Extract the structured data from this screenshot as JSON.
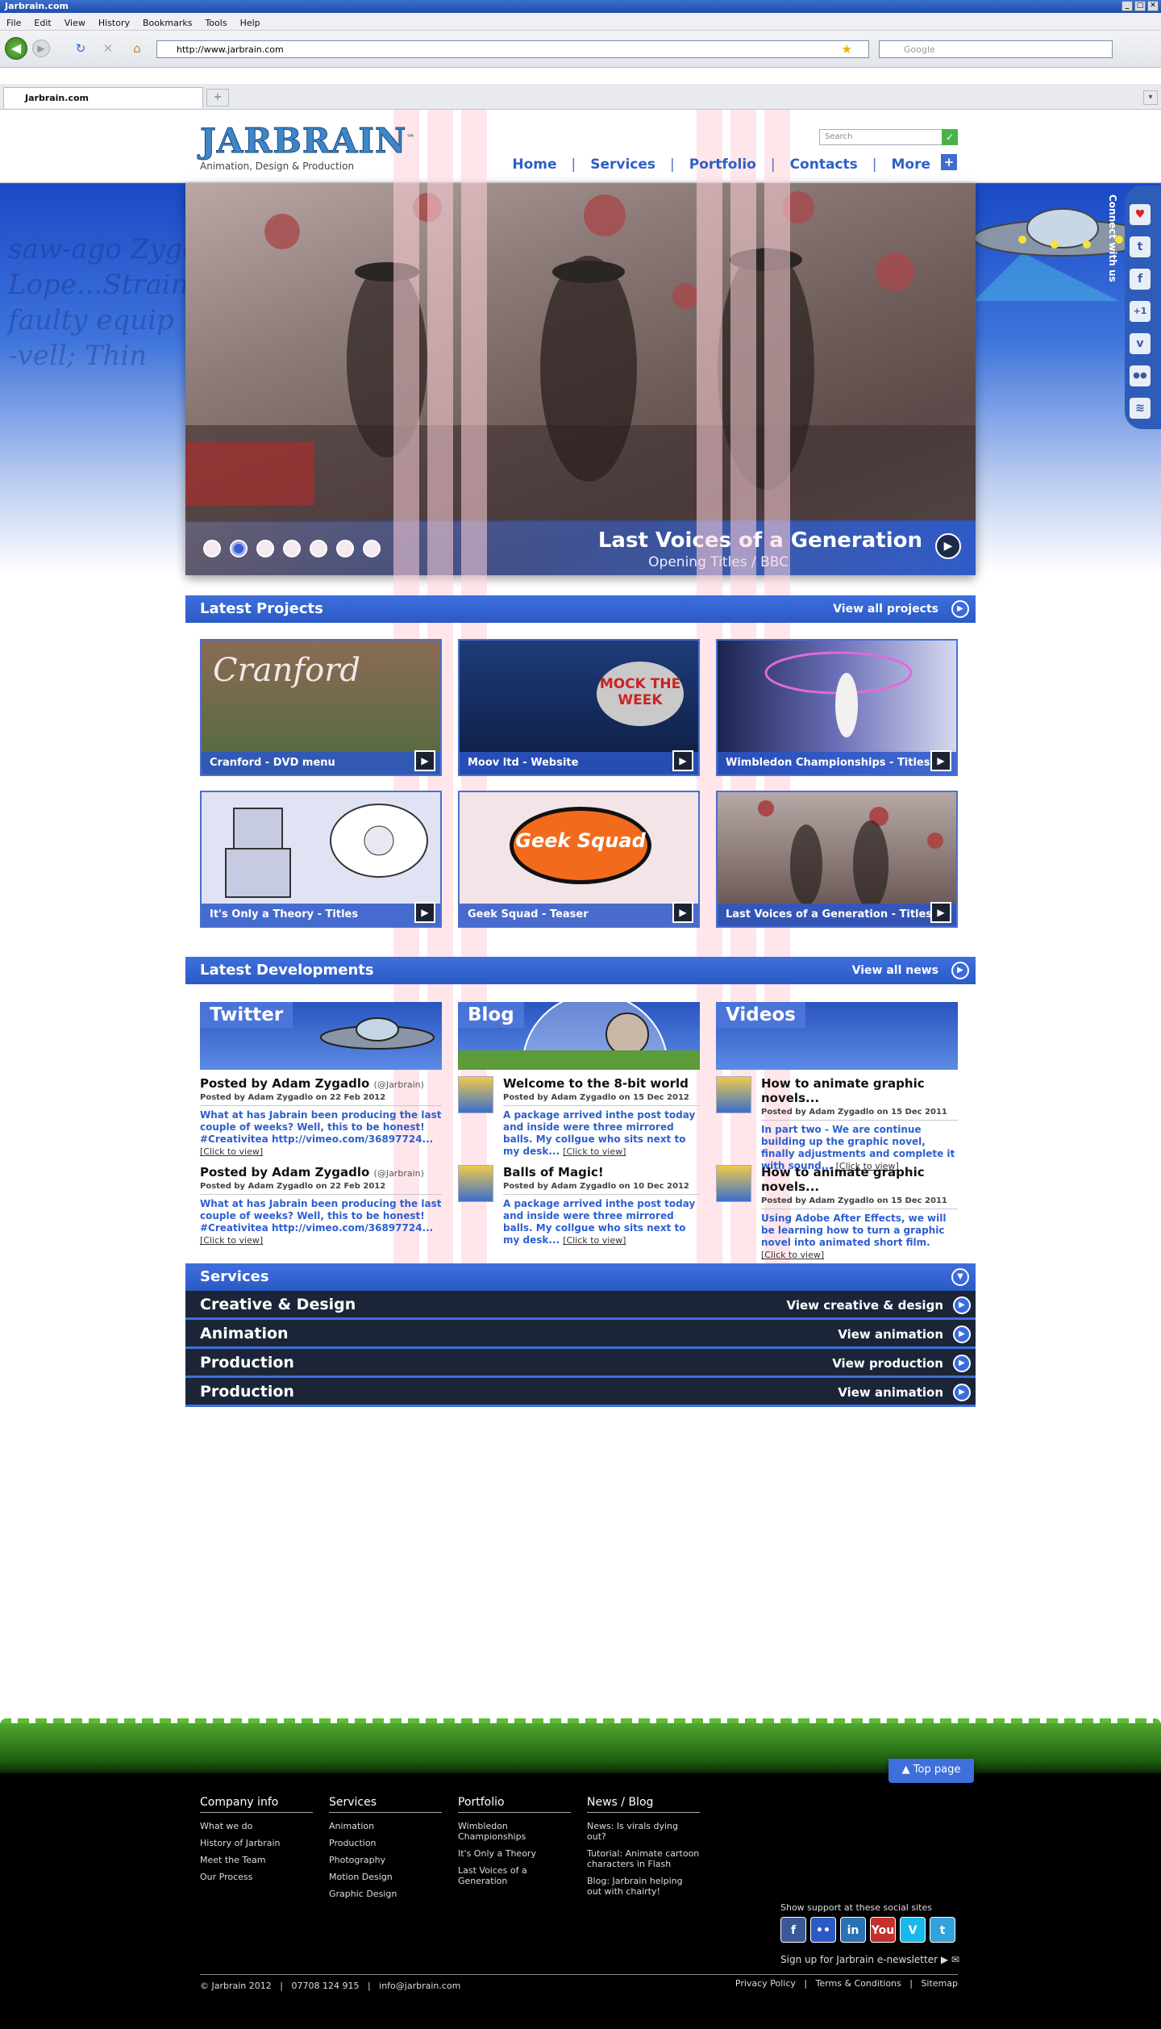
{
  "browser": {
    "window_title": "Jarbrain.com",
    "menus": [
      "File",
      "Edit",
      "View",
      "History",
      "Bookmarks",
      "Tools",
      "Help"
    ],
    "url": "http://www.jarbrain.com",
    "search_placeholder": "Google",
    "tab_title": "Jarbrain.com"
  },
  "header": {
    "logo": "JARBRAIN",
    "tm": "™",
    "tagline": "Animation, Design & Production",
    "search_placeholder": "Search",
    "nav": [
      "Home",
      "Services",
      "Portfolio",
      "Contacts",
      "More"
    ],
    "nav_sep": "|"
  },
  "hero": {
    "title": "Last Voices of a Generation",
    "subtitle": "Opening Titles / BBC",
    "slide_count": 7,
    "active_slide": 2,
    "ghost_text": [
      "saw-ago Zygad",
      "Lope...Strain",
      "faulty equip",
      "-vell; Thin"
    ],
    "connect": "Connect with us"
  },
  "latest_projects": {
    "title": "Latest Projects",
    "link": "View all projects",
    "items": [
      {
        "label": "Cranford - DVD menu",
        "art": "Cranford"
      },
      {
        "label": "Moov ltd - Website",
        "art": "MOCK THE WEEK"
      },
      {
        "label": "Wimbledon Championships - Titles",
        "art": ""
      },
      {
        "label": "It's Only a Theory - Titles",
        "art": ""
      },
      {
        "label": "Geek Squad - Teaser",
        "art": "Geek Squad"
      },
      {
        "label": "Last Voices of a Generation - Titles",
        "art": ""
      }
    ]
  },
  "latest_developments": {
    "title": "Latest Developments",
    "link": "View all news",
    "click_label": "[Click to view]",
    "columns": [
      {
        "label": "Twitter",
        "posts": [
          {
            "title": "Posted by Adam Zygadlo",
            "handle": "(@Jarbrain)",
            "meta": "Posted by Adam Zygadlo on 22 Feb 2012",
            "body": "What at has Jabrain been producing the last couple of weeks? Well, this to be honest! #Creativitea http://vimeo.com/36897724..."
          },
          {
            "title": "Posted by Adam Zygadlo",
            "handle": "(@Jarbrain)",
            "meta": "Posted by Adam Zygadlo on 22 Feb 2012",
            "body": "What at has Jabrain been producing the last couple of weeks? Well, this to be honest! #Creativitea http://vimeo.com/36897724..."
          }
        ]
      },
      {
        "label": "Blog",
        "posts": [
          {
            "title": "Welcome to the 8-bit world",
            "meta": "Posted by Adam Zygadlo on 15 Dec 2012",
            "body": "A package arrived inthe post today and inside were three mirrored balls. My collgue who sits next to my desk..."
          },
          {
            "title": "Balls of Magic!",
            "meta": "Posted by Adam Zygadlo on 10 Dec 2012",
            "body": "A package arrived inthe post today and inside were three mirrored balls. My collgue who sits next to my desk..."
          }
        ]
      },
      {
        "label": "Videos",
        "posts": [
          {
            "title": "How to animate graphic novels...",
            "meta": "Posted by Adam Zygadlo on 15 Dec 2011",
            "body": "In part two - We are continue building up the graphic novel, finally adjustments and complete it with sound..."
          },
          {
            "title": "How to animate graphic novels...",
            "meta": "Posted by Adam Zygadlo on 15 Dec 2011",
            "body": "Using Adobe After Effects, we will be learning how to turn a graphic novel into animated short film."
          }
        ]
      }
    ]
  },
  "services": {
    "title": "Services",
    "rows": [
      {
        "label": "Creative & Design",
        "link": "View creative & design"
      },
      {
        "label": "Animation",
        "link": "View animation"
      },
      {
        "label": "Production",
        "link": "View production"
      },
      {
        "label": "Production",
        "link": "View animation"
      }
    ]
  },
  "footer": {
    "top_page": "▲ Top page",
    "columns": [
      {
        "title": "Company info",
        "links": [
          "What we do",
          "History of Jarbrain",
          "Meet the Team",
          "Our Process"
        ]
      },
      {
        "title": "Services",
        "links": [
          "Animation",
          "Production",
          "Photography",
          "Motion Design",
          "Graphic Design"
        ]
      },
      {
        "title": "Portfolio",
        "links": [
          "Wimbledon Championships",
          "It's Only a Theory",
          "Last Voices of a Generation"
        ]
      },
      {
        "title": "News / Blog",
        "links": [
          "News: Is virals dying out?",
          "Tutorial: Animate cartoon characters in Flash",
          "Blog: Jarbrain helping out with chairty!"
        ]
      }
    ],
    "support_label": "Show support at these social sites",
    "social": [
      {
        "name": "facebook-icon",
        "glyph": "f",
        "color": "#3b5998"
      },
      {
        "name": "flickr-icon",
        "glyph": "••",
        "color": "#2b5ac6"
      },
      {
        "name": "linkedin-icon",
        "glyph": "in",
        "color": "#2a72b5"
      },
      {
        "name": "youtube-icon",
        "glyph": "You",
        "color": "#c4302b"
      },
      {
        "name": "vimeo-icon",
        "glyph": "V",
        "color": "#1ab7ea"
      },
      {
        "name": "twitter-icon",
        "glyph": "t",
        "color": "#33a3dc"
      }
    ],
    "newsletter": "Sign up for Jarbrain e-newsletter ▶",
    "copyright": "© Jarbrain 2012",
    "phone": "07708 124 915",
    "email": "info@jarbrain.com",
    "legal": [
      "Privacy Policy",
      "Terms & Conditions",
      "Sitemap"
    ]
  }
}
